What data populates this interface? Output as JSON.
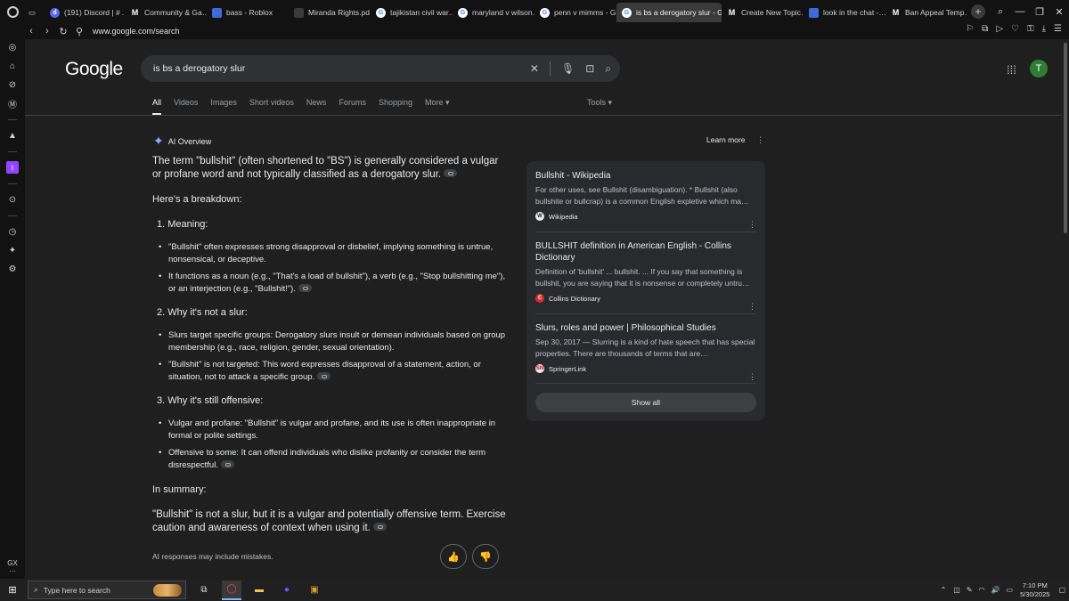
{
  "browser": {
    "tabs": [
      {
        "label": "(191) Discord | # …",
        "favicon": "discord-icon",
        "fav_char": "d",
        "fav_class": "d",
        "width": 90
      },
      {
        "label": "Community & Ga…",
        "favicon": "m-icon",
        "fav_char": "M",
        "fav_class": "m",
        "width": 92
      },
      {
        "label": "bass - Roblox",
        "favicon": "roblox-icon",
        "fav_char": "",
        "fav_class": "b",
        "width": 92
      },
      {
        "label": "Miranda Rights.pd…",
        "favicon": "file-icon",
        "fav_char": "",
        "fav_class": "r",
        "width": 92
      },
      {
        "label": "tajikistan civil war…",
        "favicon": "google-icon",
        "fav_char": "G",
        "fav_class": "g",
        "width": 92
      },
      {
        "label": "maryland v wilson…",
        "favicon": "google-icon",
        "fav_char": "G",
        "fav_class": "g",
        "width": 92
      },
      {
        "label": "penn v mimms - G…",
        "favicon": "google-icon",
        "fav_char": "G",
        "fav_class": "g",
        "width": 92
      },
      {
        "label": "is bs a derogatory slur - G…",
        "favicon": "google-icon",
        "fav_char": "G",
        "fav_class": "g",
        "width": 118,
        "active": true
      },
      {
        "label": "Create New Topic…",
        "favicon": "m-icon",
        "fav_char": "M",
        "fav_class": "m",
        "width": 92
      },
      {
        "label": "look in the chat -…",
        "favicon": "docs-icon",
        "fav_char": "",
        "fav_class": "b",
        "width": 92
      },
      {
        "label": "Ban Appeal Temp…",
        "favicon": "m-icon",
        "fav_char": "M",
        "fav_class": "m",
        "width": 92
      }
    ],
    "url": "www.google.com/search"
  },
  "google": {
    "logo": "Google",
    "query": "is bs a derogatory slur",
    "avatar_letter": "T",
    "nav_tabs": [
      "All",
      "Videos",
      "Images",
      "Short videos",
      "News",
      "Forums",
      "Shopping",
      "More ▾"
    ],
    "tools": "Tools ▾"
  },
  "ai_overview": {
    "header": "AI Overview",
    "learn_more": "Learn more",
    "intro": "The term \"bullshit\" (often shortened to \"BS\") is generally considered a vulgar or profane word and not typically classified as a derogatory slur.",
    "breakdown": "Here's a breakdown:",
    "s1_title": "1.  Meaning:",
    "s1_b1": "\"Bullshit\" often expresses strong disapproval or disbelief, implying something is untrue, nonsensical, or deceptive.",
    "s1_b2": "It functions as a noun (e.g., \"That's a load of bullshit\"), a verb (e.g., \"Stop bullshitting me\"), or an interjection (e.g., \"Bullshit!\").",
    "s2_title": "2.  Why it's not a slur:",
    "s2_b1": "Slurs target specific groups: Derogatory slurs insult or demean individuals based on group membership (e.g., race, religion, gender, sexual orientation).",
    "s2_b2": "\"Bullshit\" is not targeted: This word expresses disapproval of a statement, action, or situation, not to attack a specific group.",
    "s3_title": "3.  Why it's still offensive:",
    "s3_b1": "Vulgar and profane: \"Bullshit\" is vulgar and profane, and its use is often inappropriate in formal or polite settings.",
    "s3_b2": "Offensive to some: It can offend individuals who dislike profanity or consider the term disrespectful.",
    "summary_head": "In summary:",
    "summary": "\"Bullshit\" is not a slur, but it is a vulgar and potentially offensive term. Exercise caution and awareness of context when using it.",
    "mistakes": "AI responses may include mistakes."
  },
  "sources": [
    {
      "title": "Bullshit - Wikipedia",
      "desc": "For other uses, see Bullshit (disambiguation). * Bullshit (also bullshite or bullcrap) is a common English expletive which ma…",
      "site": "Wikipedia",
      "fav": "W"
    },
    {
      "title": "BULLSHIT definition in American English - Collins Dictionary",
      "desc": "Definition of 'bullshit' ... bullshit. ... If you say that something is bullshit, you are saying that it is nonsense or completely untru…",
      "site": "Collins Dictionary",
      "fav": "C"
    },
    {
      "title": "Slurs, roles and power | Philosophical Studies",
      "desc": "Sep 30, 2017 — Slurring is a kind of hate speech that has special properties. There are thousands of terms that are…",
      "site": "SpringerLink",
      "fav": "SN"
    }
  ],
  "show_all": "Show all",
  "sidebar_bottom": "GX",
  "taskbar": {
    "search_placeholder": "Type here to search",
    "time": "7:10 PM",
    "date": "5/30/2025"
  },
  "colors": {
    "accent": "#8ab4f8",
    "avatar": "#2e7d32",
    "twitch": "#9146ff"
  }
}
